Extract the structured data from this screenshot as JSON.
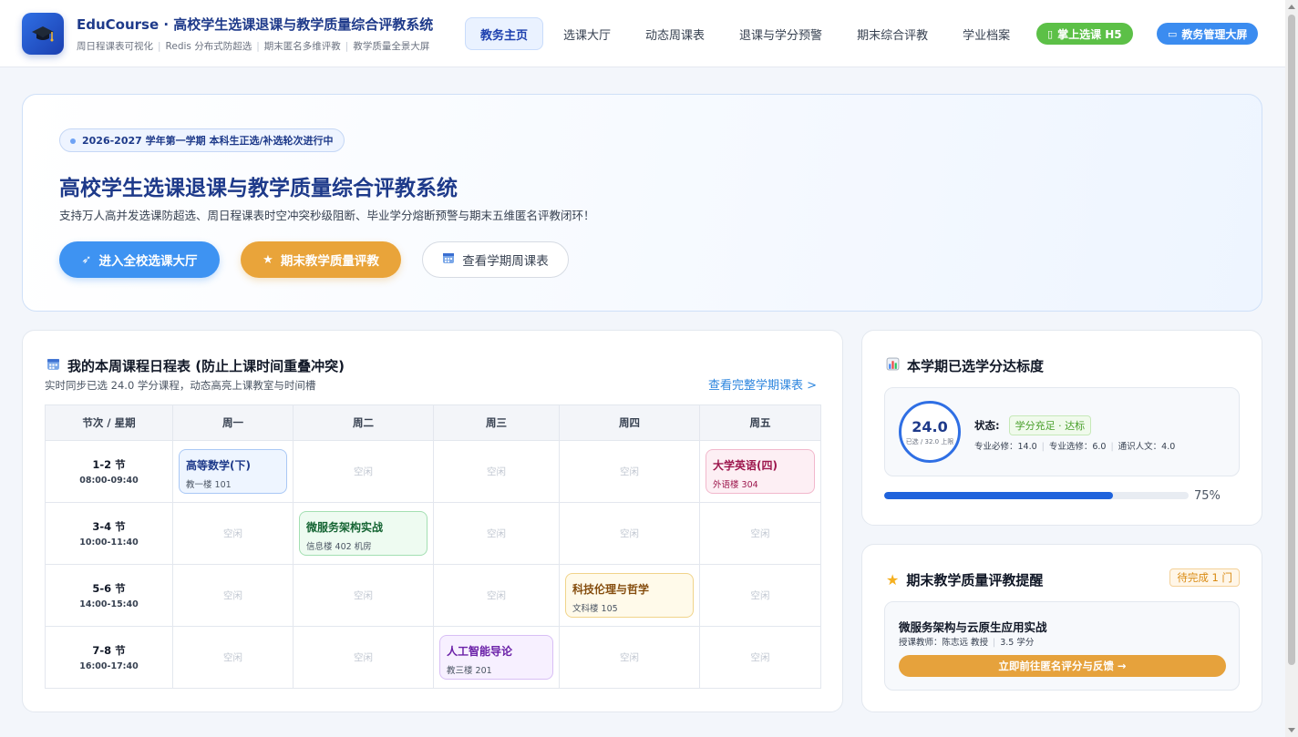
{
  "brand": {
    "title": "EduCourse · 高校学生选课退课与教学质量综合评教系统",
    "features": [
      "周日程课表可视化",
      "Redis 分布式防超选",
      "期末匿名多维评教",
      "教学质量全景大屏"
    ],
    "logo_icon": "graduation-cap-icon"
  },
  "nav": {
    "items": [
      "教务主页",
      "选课大厅",
      "动态周课表",
      "退课与学分预警",
      "期末综合评教",
      "学业档案"
    ],
    "active_index": 0,
    "mobile_btn": "掌上选课 H5",
    "dashboard_btn": "教务管理大屏"
  },
  "hero": {
    "badge": "2026-2027 学年第一学期 本科生正选/补选轮次进行中",
    "title": "高校学生选课退课与教学质量综合评教系统",
    "desc": "支持万人高并发选课防超选、周日程课表时空冲突秒级阻断、毕业学分熔断预警与期末五维匿名评教闭环！",
    "btn_select": "进入全校选课大厅",
    "btn_eval": "期末教学质量评教",
    "btn_schedule": "查看学期周课表"
  },
  "schedule": {
    "title": "我的本周课程日程表 (防止上课时间重叠冲突)",
    "subtitle": "实时同步已选 24.0 学分课程，动态高亮上课教室与时间槽",
    "link": "查看完整学期课表 >",
    "corner_header": "节次 / 星期",
    "days": [
      "周一",
      "周二",
      "周三",
      "周四",
      "周五"
    ],
    "empty_label": "空闲",
    "slots": [
      {
        "name": "1-2 节",
        "time": "08:00-09:40"
      },
      {
        "name": "3-4 节",
        "time": "10:00-11:40"
      },
      {
        "name": "5-6 节",
        "time": "14:00-15:40"
      },
      {
        "name": "7-8 节",
        "time": "16:00-17:40"
      }
    ],
    "courses": [
      {
        "slot": 0,
        "day": 0,
        "name": "高等数学(下)",
        "room": "教一楼 101",
        "color": "blue"
      },
      {
        "slot": 0,
        "day": 4,
        "name": "大学英语(四)",
        "room": "外语楼 304",
        "color": "pink"
      },
      {
        "slot": 1,
        "day": 1,
        "name": "微服务架构实战",
        "room": "信息楼 402 机房",
        "color": "green"
      },
      {
        "slot": 2,
        "day": 3,
        "name": "科技伦理与哲学",
        "room": "文科楼 105",
        "color": "yellow"
      },
      {
        "slot": 3,
        "day": 2,
        "name": "人工智能导论",
        "room": "教三楼 201",
        "color": "purple"
      }
    ]
  },
  "credits": {
    "title": "本学期已选学分达标度",
    "value": "24.0",
    "ring_sub": "已选 / 32.0 上限",
    "status_label": "状态:",
    "status_tag": "学分充足 · 达标",
    "breakdown": [
      "专业必修：14.0",
      "专业选修：6.0",
      "通识人文：4.0"
    ],
    "progress": 75,
    "progress_text": "75%"
  },
  "evaluation": {
    "title": "期末教学质量评教提醒",
    "pending": "待完成 1 门",
    "course_name": "微服务架构与云原生应用实战",
    "teacher": "授课教师：陈志远 教授",
    "credit": "3.5 学分",
    "action": "立即前往匿名评分与反馈 →"
  }
}
